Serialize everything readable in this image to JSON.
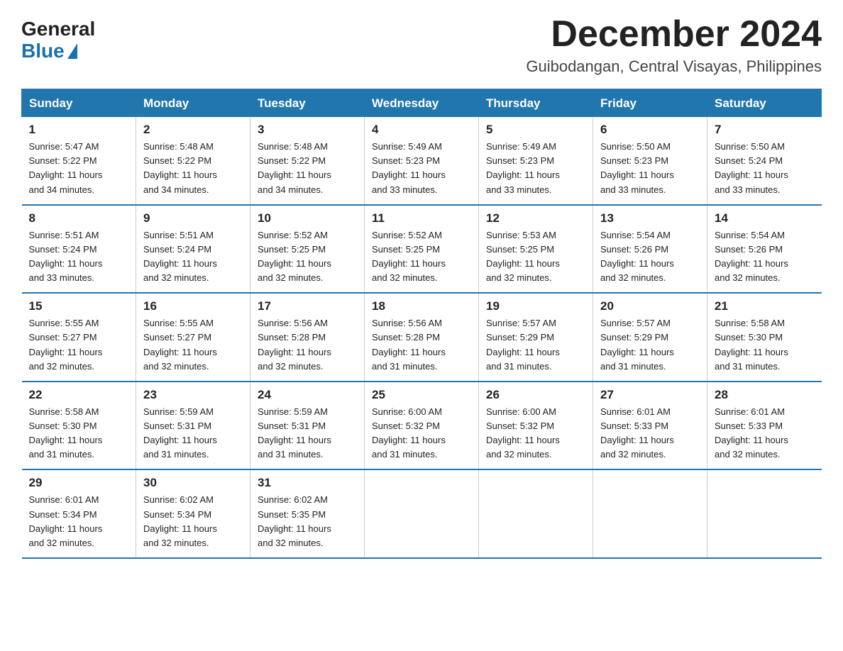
{
  "logo": {
    "general": "General",
    "blue": "Blue"
  },
  "header": {
    "month_year": "December 2024",
    "location": "Guibodangan, Central Visayas, Philippines"
  },
  "days_of_week": [
    "Sunday",
    "Monday",
    "Tuesday",
    "Wednesday",
    "Thursday",
    "Friday",
    "Saturday"
  ],
  "weeks": [
    [
      {
        "day": "1",
        "sunrise": "5:47 AM",
        "sunset": "5:22 PM",
        "daylight": "11 hours and 34 minutes."
      },
      {
        "day": "2",
        "sunrise": "5:48 AM",
        "sunset": "5:22 PM",
        "daylight": "11 hours and 34 minutes."
      },
      {
        "day": "3",
        "sunrise": "5:48 AM",
        "sunset": "5:22 PM",
        "daylight": "11 hours and 34 minutes."
      },
      {
        "day": "4",
        "sunrise": "5:49 AM",
        "sunset": "5:23 PM",
        "daylight": "11 hours and 33 minutes."
      },
      {
        "day": "5",
        "sunrise": "5:49 AM",
        "sunset": "5:23 PM",
        "daylight": "11 hours and 33 minutes."
      },
      {
        "day": "6",
        "sunrise": "5:50 AM",
        "sunset": "5:23 PM",
        "daylight": "11 hours and 33 minutes."
      },
      {
        "day": "7",
        "sunrise": "5:50 AM",
        "sunset": "5:24 PM",
        "daylight": "11 hours and 33 minutes."
      }
    ],
    [
      {
        "day": "8",
        "sunrise": "5:51 AM",
        "sunset": "5:24 PM",
        "daylight": "11 hours and 33 minutes."
      },
      {
        "day": "9",
        "sunrise": "5:51 AM",
        "sunset": "5:24 PM",
        "daylight": "11 hours and 32 minutes."
      },
      {
        "day": "10",
        "sunrise": "5:52 AM",
        "sunset": "5:25 PM",
        "daylight": "11 hours and 32 minutes."
      },
      {
        "day": "11",
        "sunrise": "5:52 AM",
        "sunset": "5:25 PM",
        "daylight": "11 hours and 32 minutes."
      },
      {
        "day": "12",
        "sunrise": "5:53 AM",
        "sunset": "5:25 PM",
        "daylight": "11 hours and 32 minutes."
      },
      {
        "day": "13",
        "sunrise": "5:54 AM",
        "sunset": "5:26 PM",
        "daylight": "11 hours and 32 minutes."
      },
      {
        "day": "14",
        "sunrise": "5:54 AM",
        "sunset": "5:26 PM",
        "daylight": "11 hours and 32 minutes."
      }
    ],
    [
      {
        "day": "15",
        "sunrise": "5:55 AM",
        "sunset": "5:27 PM",
        "daylight": "11 hours and 32 minutes."
      },
      {
        "day": "16",
        "sunrise": "5:55 AM",
        "sunset": "5:27 PM",
        "daylight": "11 hours and 32 minutes."
      },
      {
        "day": "17",
        "sunrise": "5:56 AM",
        "sunset": "5:28 PM",
        "daylight": "11 hours and 32 minutes."
      },
      {
        "day": "18",
        "sunrise": "5:56 AM",
        "sunset": "5:28 PM",
        "daylight": "11 hours and 31 minutes."
      },
      {
        "day": "19",
        "sunrise": "5:57 AM",
        "sunset": "5:29 PM",
        "daylight": "11 hours and 31 minutes."
      },
      {
        "day": "20",
        "sunrise": "5:57 AM",
        "sunset": "5:29 PM",
        "daylight": "11 hours and 31 minutes."
      },
      {
        "day": "21",
        "sunrise": "5:58 AM",
        "sunset": "5:30 PM",
        "daylight": "11 hours and 31 minutes."
      }
    ],
    [
      {
        "day": "22",
        "sunrise": "5:58 AM",
        "sunset": "5:30 PM",
        "daylight": "11 hours and 31 minutes."
      },
      {
        "day": "23",
        "sunrise": "5:59 AM",
        "sunset": "5:31 PM",
        "daylight": "11 hours and 31 minutes."
      },
      {
        "day": "24",
        "sunrise": "5:59 AM",
        "sunset": "5:31 PM",
        "daylight": "11 hours and 31 minutes."
      },
      {
        "day": "25",
        "sunrise": "6:00 AM",
        "sunset": "5:32 PM",
        "daylight": "11 hours and 31 minutes."
      },
      {
        "day": "26",
        "sunrise": "6:00 AM",
        "sunset": "5:32 PM",
        "daylight": "11 hours and 32 minutes."
      },
      {
        "day": "27",
        "sunrise": "6:01 AM",
        "sunset": "5:33 PM",
        "daylight": "11 hours and 32 minutes."
      },
      {
        "day": "28",
        "sunrise": "6:01 AM",
        "sunset": "5:33 PM",
        "daylight": "11 hours and 32 minutes."
      }
    ],
    [
      {
        "day": "29",
        "sunrise": "6:01 AM",
        "sunset": "5:34 PM",
        "daylight": "11 hours and 32 minutes."
      },
      {
        "day": "30",
        "sunrise": "6:02 AM",
        "sunset": "5:34 PM",
        "daylight": "11 hours and 32 minutes."
      },
      {
        "day": "31",
        "sunrise": "6:02 AM",
        "sunset": "5:35 PM",
        "daylight": "11 hours and 32 minutes."
      },
      null,
      null,
      null,
      null
    ]
  ],
  "labels": {
    "sunrise": "Sunrise:",
    "sunset": "Sunset:",
    "daylight": "Daylight:"
  }
}
